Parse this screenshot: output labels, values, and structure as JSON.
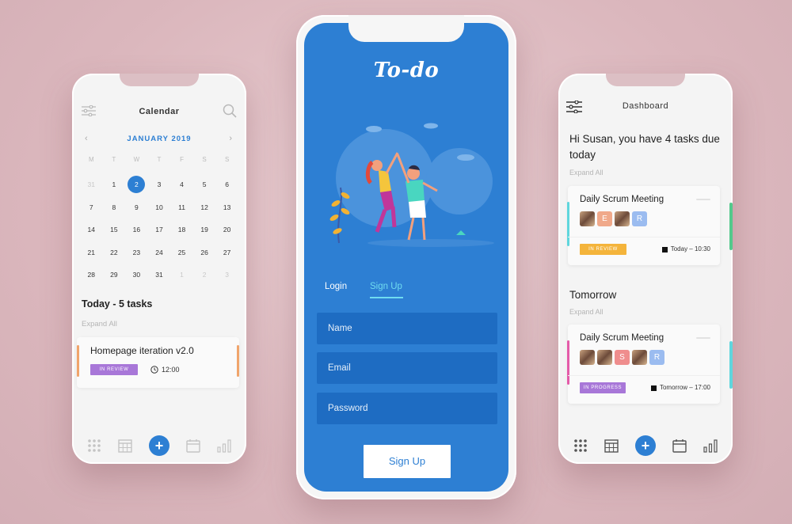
{
  "calendar_screen": {
    "title": "Calendar",
    "month": "JANUARY 2019",
    "weekdays": [
      "M",
      "T",
      "W",
      "T",
      "F",
      "S",
      "S"
    ],
    "weeks": [
      [
        {
          "d": "31",
          "m": true
        },
        {
          "d": "1"
        },
        {
          "d": "2",
          "sel": true
        },
        {
          "d": "3"
        },
        {
          "d": "4"
        },
        {
          "d": "5"
        },
        {
          "d": "6"
        }
      ],
      [
        {
          "d": "7"
        },
        {
          "d": "8"
        },
        {
          "d": "9"
        },
        {
          "d": "10"
        },
        {
          "d": "11"
        },
        {
          "d": "12"
        },
        {
          "d": "13"
        }
      ],
      [
        {
          "d": "14"
        },
        {
          "d": "15"
        },
        {
          "d": "16"
        },
        {
          "d": "17"
        },
        {
          "d": "18"
        },
        {
          "d": "19"
        },
        {
          "d": "20"
        }
      ],
      [
        {
          "d": "21"
        },
        {
          "d": "22"
        },
        {
          "d": "23"
        },
        {
          "d": "24"
        },
        {
          "d": "25"
        },
        {
          "d": "26"
        },
        {
          "d": "27"
        }
      ],
      [
        {
          "d": "28"
        },
        {
          "d": "29"
        },
        {
          "d": "30"
        },
        {
          "d": "31"
        },
        {
          "d": "1",
          "m": true
        },
        {
          "d": "2",
          "m": true
        },
        {
          "d": "3",
          "m": true
        }
      ]
    ],
    "today_heading": "Today - 5 tasks",
    "expand_all": "Expand All",
    "task": {
      "title": "Homepage iteration v2.0",
      "status": "IN REVIEW",
      "time": "12:00"
    },
    "icons": [
      "filter-icon",
      "search-icon",
      "grid-icon",
      "calendar-grid-icon",
      "plus-icon",
      "calendar-icon",
      "bar-chart-icon"
    ]
  },
  "signup_screen": {
    "logo": "To-do",
    "tabs": {
      "login": "Login",
      "signup": "Sign Up"
    },
    "fields": {
      "name": "Name",
      "email": "Email",
      "password": "Password"
    },
    "submit": "Sign Up"
  },
  "dashboard_screen": {
    "title": "Dashboard",
    "greeting": "Hi Susan, you have 4 tasks due today",
    "expand_all": "Expand All",
    "today_card": {
      "title": "Daily Scrum Meeting",
      "avatars": [
        {
          "type": "photo"
        },
        {
          "type": "letter",
          "letter": "E",
          "color": "#f0a98a"
        },
        {
          "type": "photo"
        },
        {
          "type": "letter",
          "letter": "R",
          "color": "#9bbcf0"
        }
      ],
      "status": "IN REVIEW",
      "time": "Today – 10:30"
    },
    "tomorrow_heading": "Tomorrow",
    "tomorrow_expand_all": "Expand All",
    "tomorrow_card": {
      "title": "Daily Scrum Meeting",
      "avatars": [
        {
          "type": "photo"
        },
        {
          "type": "photo"
        },
        {
          "type": "letter",
          "letter": "S",
          "color": "#ef8d8d"
        },
        {
          "type": "photo"
        },
        {
          "type": "letter",
          "letter": "R",
          "color": "#9bbcf0"
        }
      ],
      "status": "IN PROGRESS",
      "time": "Tomorrow – 17:00"
    }
  },
  "colors": {
    "accent": "#2d7fd3",
    "review_purple": "#a877d8",
    "review_yellow": "#f4b43b",
    "signup_tab": "#6fdcf0",
    "orange_bar": "#f0a46b",
    "teal_bar": "#5fd6dd",
    "green_bar": "#53c98c",
    "pink_bar": "#e45ba9"
  }
}
